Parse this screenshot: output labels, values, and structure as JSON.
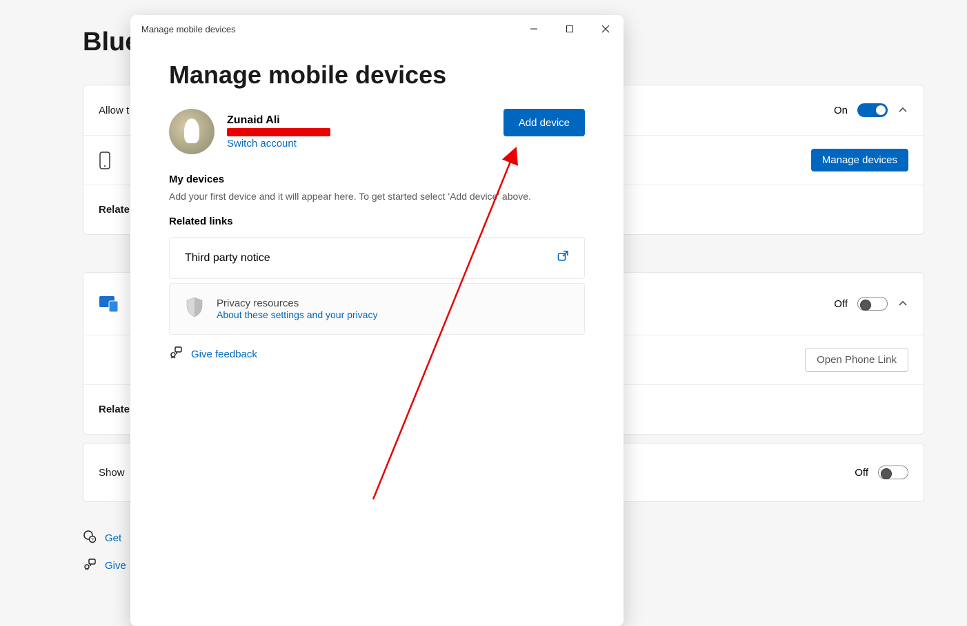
{
  "background": {
    "page_title_partial": "Bluet",
    "rows": {
      "allow_label_partial": "Allow t",
      "allow_state": "On",
      "manage_devices_button": "Manage devices",
      "related_partial": "Relate",
      "phone_link_state": "Off",
      "open_phone_link_button": "Open Phone Link",
      "show_label_partial": "Show ",
      "show_state": "Off"
    },
    "footer": {
      "get_partial": "Get",
      "give_partial": "Give"
    }
  },
  "dialog": {
    "titlebar": "Manage mobile devices",
    "heading": "Manage mobile devices",
    "user": {
      "name": "Zunaid Ali",
      "switch_account": "Switch account"
    },
    "add_device_button": "Add device",
    "sections": {
      "my_devices_title": "My devices",
      "my_devices_desc": "Add your first device and it will appear here. To get started select 'Add device' above.",
      "related_links_title": "Related links",
      "third_party_notice": "Third party notice",
      "privacy_title": "Privacy resources",
      "privacy_link": "About these settings and your privacy",
      "feedback": "Give feedback"
    }
  }
}
